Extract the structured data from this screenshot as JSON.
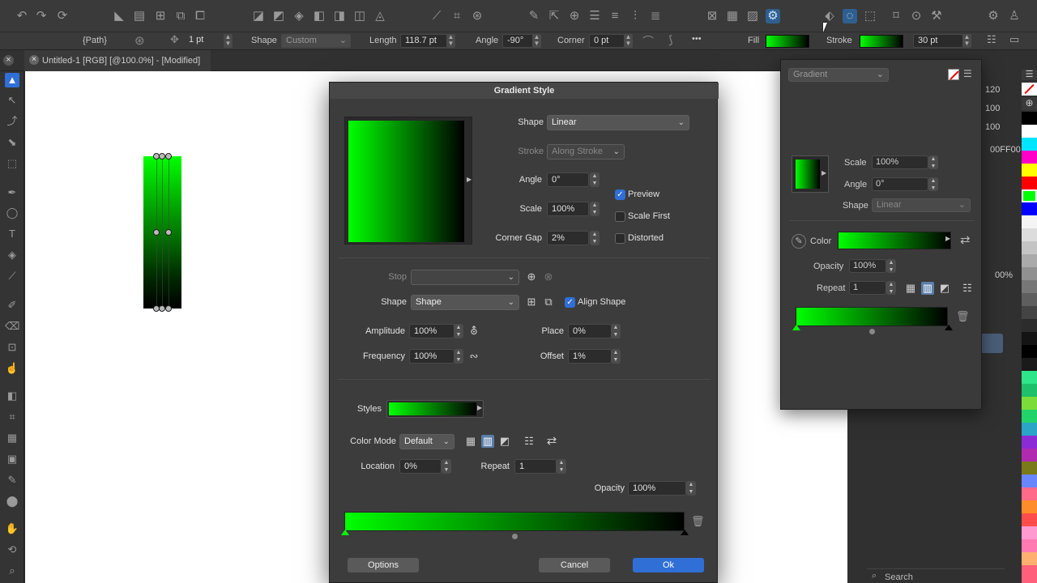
{
  "top_toolbar": {
    "icons": [
      "undo-icon",
      "redo-icon",
      "refresh-icon",
      "perspective-icon",
      "insert-icon",
      "resize-icon",
      "arrange-icon",
      "duplicate-icon",
      "boolean-add-icon",
      "boolean-subtract-icon",
      "boolean-intersect-icon",
      "boolean-exclude-icon",
      "boolean-divide-icon",
      "boolean-combine-icon",
      "boolean-xor-icon",
      "node-tool-icon",
      "crop-icon",
      "pattern-icon",
      "edit-icon",
      "export-icon",
      "grid-icon",
      "align-top-icon",
      "align-bottom-icon",
      "align-center-icon",
      "distribute-icon",
      "snap-icon",
      "guides-icon",
      "hatch-icon",
      "effects-icon",
      "node-icon",
      "lasso-icon",
      "select-icon",
      "transform-icon",
      "settings-icon",
      "gear-icon",
      "person-icon"
    ]
  },
  "context_bar": {
    "path_label": "{Path}",
    "stroke_width": "1 pt",
    "shape_label": "Shape",
    "shape_value": "Custom",
    "length_label": "Length",
    "length_value": "118.7 pt",
    "angle_label": "Angle",
    "angle_value": "-90°",
    "corner_label": "Corner",
    "corner_value": "0 pt",
    "more": "•••",
    "fill_label": "Fill",
    "stroke_label": "Stroke",
    "stroke_size": "30 pt"
  },
  "tab": {
    "title": "Untitled-1 [RGB] [@100.0%] - [Modified]",
    "close": "×"
  },
  "dialog": {
    "title": "Gradient Style",
    "shape_label": "Shape",
    "shape_value": "Linear",
    "stroke_label": "Stroke",
    "stroke_value": "Along Stroke",
    "angle_label": "Angle",
    "angle_value": "0°",
    "scale_label": "Scale",
    "scale_value": "100%",
    "corner_gap_label": "Corner Gap",
    "corner_gap_value": "2%",
    "preview_label": "Preview",
    "scale_first_label": "Scale First",
    "distorted_label": "Distorted",
    "stop_label": "Stop",
    "stop_shape_label": "Shape",
    "stop_shape_value": "Shape",
    "align_shape_label": "Align Shape",
    "amplitude_label": "Amplitude",
    "amplitude_value": "100%",
    "frequency_label": "Frequency",
    "frequency_value": "100%",
    "place_label": "Place",
    "place_value": "0%",
    "offset_label": "Offset",
    "offset_value": "1%",
    "styles_label": "Styles",
    "color_mode_label": "Color Mode",
    "color_mode_value": "Default",
    "location_label": "Location",
    "location_value": "0%",
    "repeat_label": "Repeat",
    "repeat_value": "1",
    "opacity_label": "Opacity",
    "opacity_value": "100%",
    "options_button": "Options",
    "cancel_button": "Cancel",
    "ok_button": "Ok"
  },
  "popover": {
    "type_value": "Gradient",
    "scale_label": "Scale",
    "scale_value": "100%",
    "angle_label": "Angle",
    "angle_value": "0°",
    "shape_label": "Shape",
    "shape_value": "Linear",
    "color_label": "Color",
    "opacity_label": "Opacity",
    "opacity_value": "100%",
    "repeat_label": "Repeat",
    "repeat_value": "1"
  },
  "right_panel": {
    "values": [
      "120",
      "100",
      "100"
    ],
    "hex_value": "00FF00",
    "percent_value": "00%",
    "search_placeholder": "Search"
  },
  "colors": {
    "gradient_start": "#00ff00",
    "gradient_end": "#000000",
    "accent": "#2f6fd6"
  }
}
